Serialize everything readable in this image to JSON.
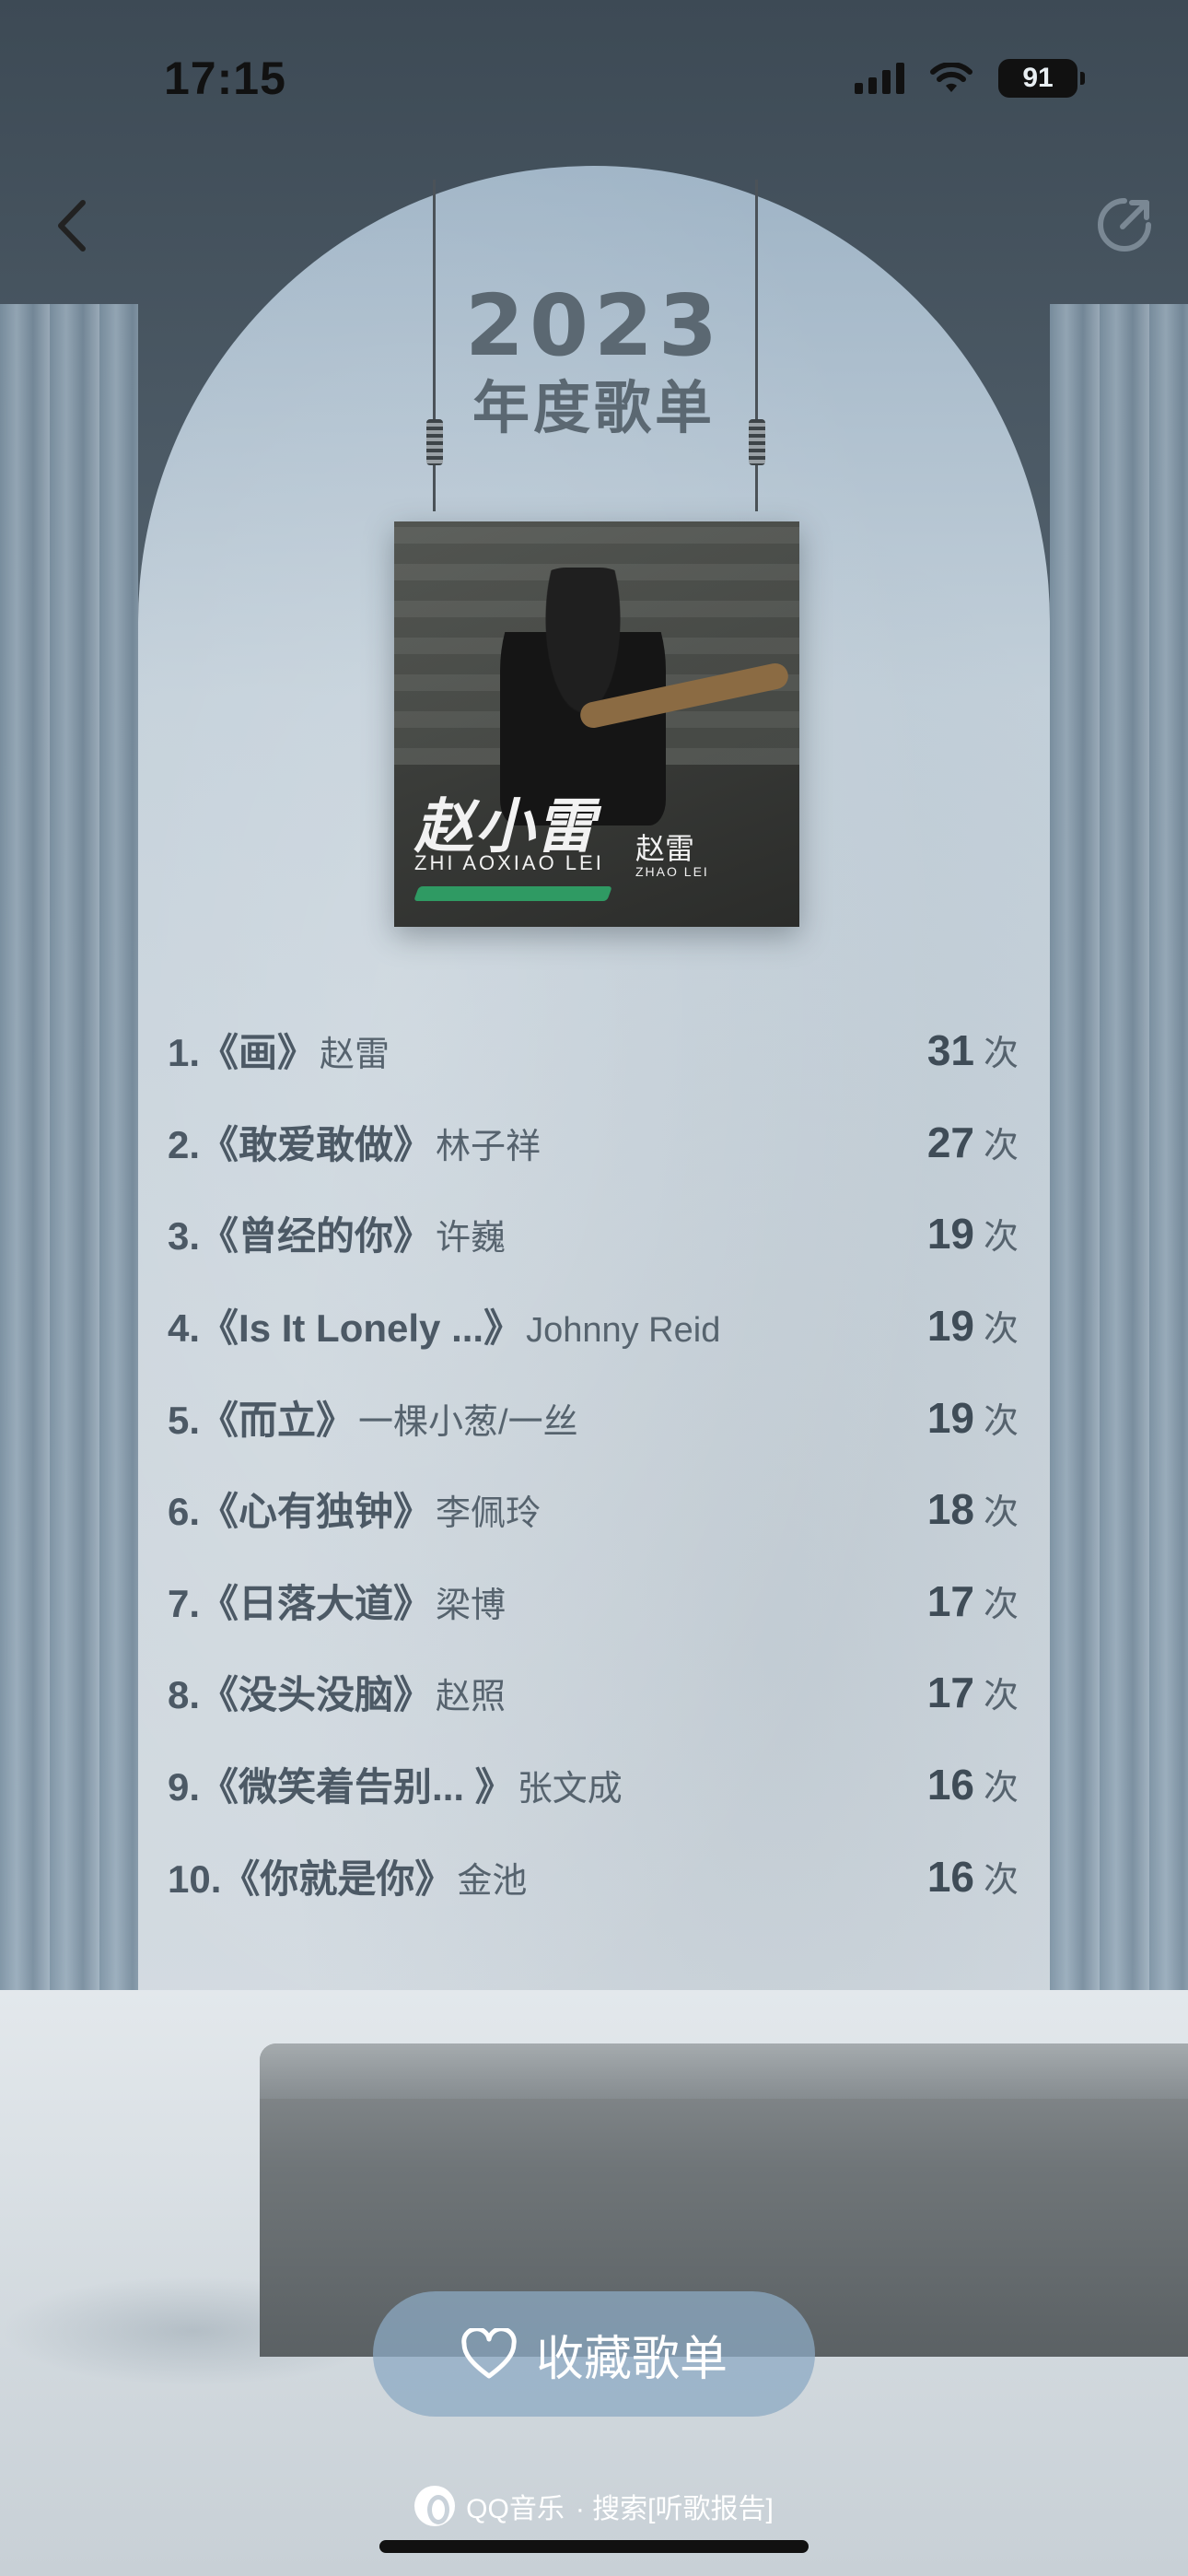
{
  "status_bar": {
    "time": "17:15",
    "battery": "91"
  },
  "nav": {
    "back_icon": "chevron-left-icon",
    "share_icon": "share-icon"
  },
  "header": {
    "year": "2023",
    "title": "年度歌单"
  },
  "album": {
    "script_text": "赵小雷",
    "sub_text": "ZHI AOXIAO LEI",
    "sign_text": "赵雷",
    "sign_sub": "ZHAO LEI",
    "colors": {
      "stroke": "#2f9a63"
    }
  },
  "ranking": [
    {
      "index": "1.",
      "title": "《画》",
      "artist": "赵雷",
      "count": "31",
      "unit": "次"
    },
    {
      "index": "2.",
      "title": "《敢爱敢做》",
      "artist": "林子祥",
      "count": "27",
      "unit": "次"
    },
    {
      "index": "3.",
      "title": "《曾经的你》",
      "artist": "许巍",
      "count": "19",
      "unit": "次"
    },
    {
      "index": "4.",
      "title": "《Is It Lonely ...》",
      "artist": "Johnny Reid",
      "count": "19",
      "unit": "次"
    },
    {
      "index": "5.",
      "title": "《而立》",
      "artist": "一棵小葱/一丝",
      "count": "19",
      "unit": "次"
    },
    {
      "index": "6.",
      "title": "《心有独钟》",
      "artist": "李佩玲",
      "count": "18",
      "unit": "次"
    },
    {
      "index": "7.",
      "title": "《日落大道》",
      "artist": "梁博",
      "count": "17",
      "unit": "次"
    },
    {
      "index": "8.",
      "title": "《没头没脑》",
      "artist": "赵照",
      "count": "17",
      "unit": "次"
    },
    {
      "index": "9.",
      "title": "《微笑着告别... 》",
      "artist": "张文成",
      "count": "16",
      "unit": "次"
    },
    {
      "index": "10.",
      "title": "《你就是你》",
      "artist": "金池",
      "count": "16",
      "unit": "次"
    }
  ],
  "actions": {
    "collect_label": "收藏歌单",
    "collect_icon": "heart-icon"
  },
  "footer": {
    "brand": "QQ音乐",
    "hint": "· 搜索[听歌报告]"
  }
}
